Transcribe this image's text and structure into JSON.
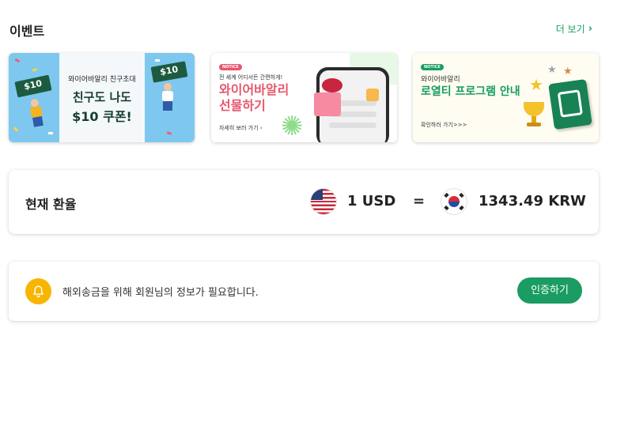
{
  "events": {
    "title": "이벤트",
    "more_label": "더 보기",
    "banners": [
      {
        "subtitle": "와이어바알리 친구초대",
        "headline_1": "친구도 나도",
        "headline_2": "$10 쿠폰!",
        "ticket_left": "$10",
        "ticket_right": "$10"
      },
      {
        "badge": "NOTICE",
        "subtitle": "전 세계 어디서든 간편하게!",
        "headline_1": "와이어바알리",
        "headline_2": "선물하기",
        "link": "자세히 보러 가기"
      },
      {
        "badge": "NOTICE",
        "subtitle": "와이어바알리",
        "headline": "로열티 프로그램 안내",
        "link": "확인하러 가기>>>"
      }
    ]
  },
  "exchange": {
    "title": "현재 환율",
    "from_amount": "1 USD",
    "equals": "=",
    "to_amount": "1343.49 KRW"
  },
  "verification": {
    "message": "해외송금을 위해 회원님의 정보가 필요합니다.",
    "button_label": "인증하기"
  },
  "colors": {
    "brand_green": "#1a9c62",
    "bell_yellow": "#f7b500",
    "gift_pink": "#e8566b"
  }
}
